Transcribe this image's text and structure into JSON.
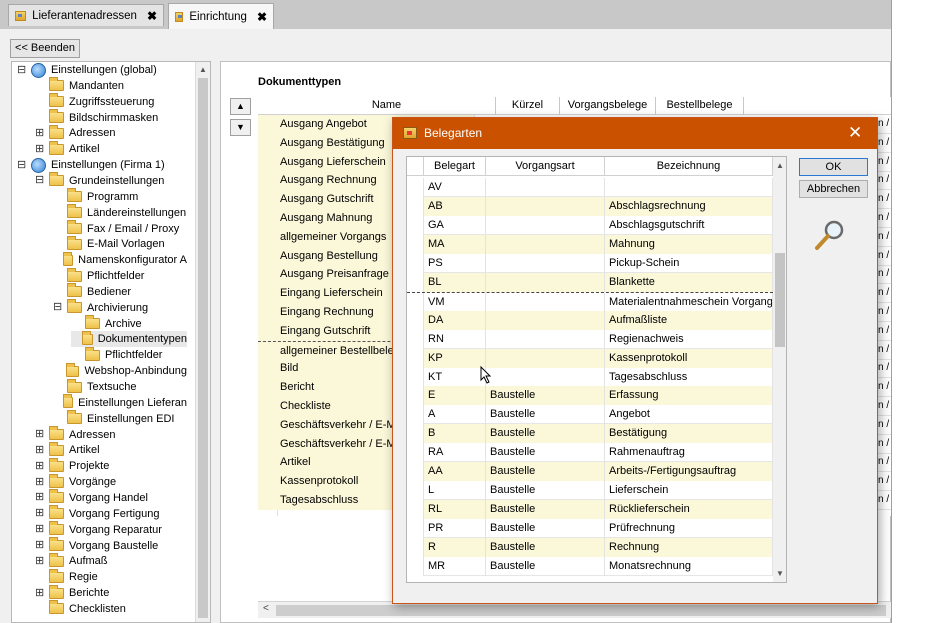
{
  "tabs": [
    {
      "label": "Lieferantenadressen",
      "close": "✖"
    },
    {
      "label": "Einrichtung",
      "close": "✖"
    }
  ],
  "toolbar": {
    "beenden_label": "<< Beenden"
  },
  "tree": [
    {
      "label": "Einstellungen (global)",
      "expander": "⊟",
      "icon": "globe-icon",
      "level": 0
    },
    {
      "label": "Mandanten",
      "icon": "folder-icon",
      "level": 1
    },
    {
      "label": "Zugriffssteuerung",
      "icon": "folder-icon",
      "level": 1
    },
    {
      "label": "Bildschirmmasken",
      "icon": "folder-icon",
      "level": 1
    },
    {
      "label": "Adressen",
      "expander": "⊞",
      "icon": "folder-icon",
      "level": 1
    },
    {
      "label": "Artikel",
      "expander": "⊞",
      "icon": "folder-icon",
      "level": 1
    },
    {
      "label": "Einstellungen (Firma 1)",
      "expander": "⊟",
      "icon": "globe-icon",
      "level": 0
    },
    {
      "label": "Grundeinstellungen",
      "expander": "⊟",
      "icon": "folder-icon",
      "level": 1
    },
    {
      "label": "Programm",
      "icon": "folder-icon",
      "level": 2
    },
    {
      "label": "Ländereinstellungen",
      "icon": "folder-icon",
      "level": 2
    },
    {
      "label": "Fax / Email / Proxy",
      "icon": "folder-icon",
      "level": 2
    },
    {
      "label": "E-Mail Vorlagen",
      "icon": "folder-icon",
      "level": 2
    },
    {
      "label": "Namenskonfigurator A",
      "icon": "folder-icon",
      "level": 2
    },
    {
      "label": "Pflichtfelder",
      "icon": "folder-icon",
      "level": 2
    },
    {
      "label": "Bediener",
      "icon": "folder-icon",
      "level": 2
    },
    {
      "label": "Archivierung",
      "expander": "⊟",
      "icon": "folder-icon",
      "level": 2
    },
    {
      "label": "Archive",
      "icon": "folder-icon",
      "level": 3
    },
    {
      "label": "Dokumententypen",
      "icon": "folder-icon",
      "level": 3,
      "selected": true
    },
    {
      "label": "Pflichtfelder",
      "icon": "folder-icon",
      "level": 3
    },
    {
      "label": "Webshop-Anbindung",
      "icon": "folder-icon",
      "level": 2
    },
    {
      "label": "Textsuche",
      "icon": "folder-icon",
      "level": 2
    },
    {
      "label": "Einstellungen Lieferan",
      "icon": "folder-icon",
      "level": 2
    },
    {
      "label": "Einstellungen EDI",
      "icon": "folder-icon",
      "level": 2
    },
    {
      "label": "Adressen",
      "expander": "⊞",
      "icon": "folder-icon",
      "level": 1
    },
    {
      "label": "Artikel",
      "expander": "⊞",
      "icon": "folder-icon",
      "level": 1
    },
    {
      "label": "Projekte",
      "expander": "⊞",
      "icon": "folder-icon",
      "level": 1
    },
    {
      "label": "Vorgänge",
      "expander": "⊞",
      "icon": "folder-icon",
      "level": 1
    },
    {
      "label": "Vorgang Handel",
      "expander": "⊞",
      "icon": "folder-icon",
      "level": 1
    },
    {
      "label": "Vorgang Fertigung",
      "expander": "⊞",
      "icon": "folder-icon",
      "level": 1
    },
    {
      "label": "Vorgang Reparatur",
      "expander": "⊞",
      "icon": "folder-icon",
      "level": 1
    },
    {
      "label": "Vorgang Baustelle",
      "expander": "⊞",
      "icon": "folder-icon",
      "level": 1
    },
    {
      "label": "Aufmaß",
      "expander": "⊞",
      "icon": "folder-icon",
      "level": 1
    },
    {
      "label": "Regie",
      "icon": "folder-icon",
      "level": 1
    },
    {
      "label": "Berichte",
      "expander": "⊞",
      "icon": "folder-icon",
      "level": 1
    },
    {
      "label": "Checklisten",
      "icon": "folder-icon",
      "level": 1
    }
  ],
  "doc_panel": {
    "title": "Dokumenttypen",
    "move_up": "▲",
    "move_down": "▼",
    "columns": [
      "Name",
      "Kürzel",
      "Vorgangsbelege",
      "Bestellbelege"
    ],
    "rows": [
      {
        "name": "Ausgang Angebot",
        "right": "n /"
      },
      {
        "name": "Ausgang Bestätigung",
        "right": "n /"
      },
      {
        "name": "Ausgang Lieferschein",
        "right": "n /"
      },
      {
        "name": "Ausgang Rechnung",
        "right": "n /"
      },
      {
        "name": "Ausgang Gutschrift",
        "right": "n /"
      },
      {
        "name": "Ausgang Mahnung",
        "right": "n /"
      },
      {
        "name": "allgemeiner Vorgangs",
        "right": "n /"
      },
      {
        "name": "Ausgang Bestellung",
        "right": "n /"
      },
      {
        "name": "Ausgang Preisanfrage",
        "right": "n /"
      },
      {
        "name": "Eingang Lieferschein",
        "right": "n /"
      },
      {
        "name": "Eingang Rechnung",
        "right": "n /"
      },
      {
        "name": "Eingang Gutschrift",
        "right": "n /"
      },
      {
        "name": "allgemeiner Bestellbele",
        "right": "n /",
        "selected": true
      },
      {
        "name": "Bild",
        "right": "n /"
      },
      {
        "name": "Bericht",
        "right": "n /"
      },
      {
        "name": "Checkliste",
        "right": "n /"
      },
      {
        "name": "Geschäftsverkehr / E-M",
        "right": "n /"
      },
      {
        "name": "Geschäftsverkehr / E-M",
        "right": "n /"
      },
      {
        "name": "Artikel",
        "right": "n /"
      },
      {
        "name": "Kassenprotokoll",
        "right": "n /"
      },
      {
        "name": "Tagesabschluss",
        "right": "n /"
      }
    ],
    "hscroll_left": "<"
  },
  "dialog": {
    "title": "Belegarten",
    "close": "✕",
    "ok_label": "OK",
    "cancel_label": "Abbrechen",
    "columns": [
      "Belegart",
      "Vorgangsart",
      "Bezeichnung"
    ],
    "rows": [
      {
        "belegart": "AV",
        "vorgangsart": "",
        "bezeichnung": ""
      },
      {
        "belegart": "AB",
        "vorgangsart": "",
        "bezeichnung": "Abschlagsrechnung"
      },
      {
        "belegart": "GA",
        "vorgangsart": "",
        "bezeichnung": "Abschlagsgutschrift"
      },
      {
        "belegart": "MA",
        "vorgangsart": "",
        "bezeichnung": "Mahnung"
      },
      {
        "belegart": "PS",
        "vorgangsart": "",
        "bezeichnung": "Pickup-Schein"
      },
      {
        "belegart": "BL",
        "vorgangsart": "",
        "bezeichnung": "Blankette"
      },
      {
        "belegart": "VM",
        "vorgangsart": "",
        "bezeichnung": "Materialentnahmeschein Vorgang",
        "selected": true
      },
      {
        "belegart": "DA",
        "vorgangsart": "",
        "bezeichnung": "Aufmaßliste"
      },
      {
        "belegart": "RN",
        "vorgangsart": "",
        "bezeichnung": "Regienachweis"
      },
      {
        "belegart": "KP",
        "vorgangsart": "",
        "bezeichnung": "Kassenprotokoll"
      },
      {
        "belegart": "KT",
        "vorgangsart": "",
        "bezeichnung": "Tagesabschluss"
      },
      {
        "belegart": "E",
        "vorgangsart": "Baustelle",
        "bezeichnung": "Erfassung"
      },
      {
        "belegart": "A",
        "vorgangsart": "Baustelle",
        "bezeichnung": "Angebot"
      },
      {
        "belegart": "B",
        "vorgangsart": "Baustelle",
        "bezeichnung": "Bestätigung"
      },
      {
        "belegart": "RA",
        "vorgangsart": "Baustelle",
        "bezeichnung": "Rahmenauftrag"
      },
      {
        "belegart": "AA",
        "vorgangsart": "Baustelle",
        "bezeichnung": "Arbeits-/Fertigungsauftrag"
      },
      {
        "belegart": "L",
        "vorgangsart": "Baustelle",
        "bezeichnung": "Lieferschein"
      },
      {
        "belegart": "RL",
        "vorgangsart": "Baustelle",
        "bezeichnung": "Rücklieferschein"
      },
      {
        "belegart": "PR",
        "vorgangsart": "Baustelle",
        "bezeichnung": "Prüfrechnung"
      },
      {
        "belegart": "R",
        "vorgangsart": "Baustelle",
        "bezeichnung": "Rechnung"
      },
      {
        "belegart": "MR",
        "vorgangsart": "Baustelle",
        "bezeichnung": "Monatsrechnung"
      }
    ]
  },
  "colors": {
    "dialog_titlebar": "#ca5100",
    "row_highlight": "#fbf7d9",
    "tab_strip": "#c8c8c8"
  }
}
